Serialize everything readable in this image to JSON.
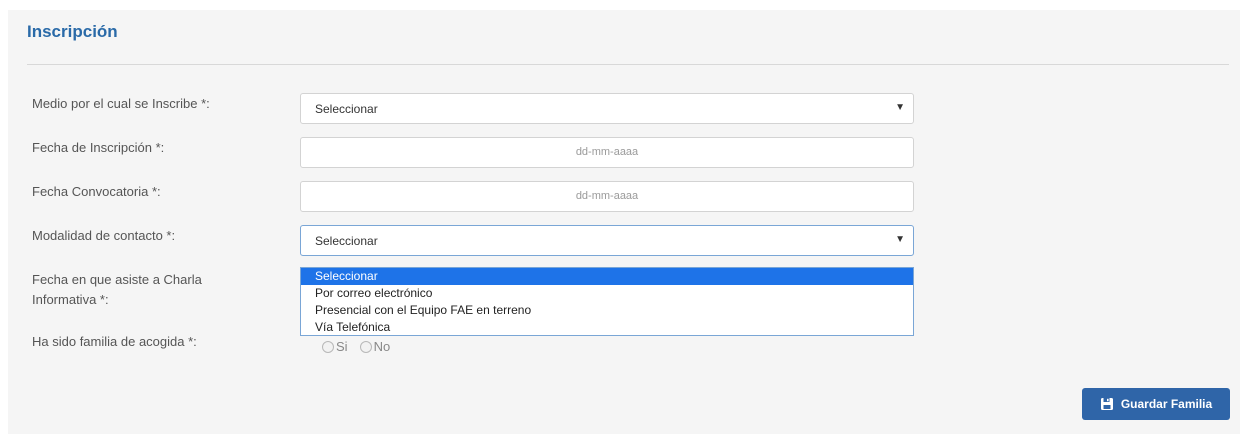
{
  "section": {
    "title": "Inscripción"
  },
  "fields": {
    "medio": {
      "label": "Medio por el cual se Inscribe *:",
      "value": "Seleccionar"
    },
    "fecha_inscripcion": {
      "label": "Fecha de Inscripción *:",
      "placeholder": "dd-mm-aaaa"
    },
    "fecha_convocatoria": {
      "label": "Fecha Convocatoria *:",
      "placeholder": "dd-mm-aaaa"
    },
    "modalidad": {
      "label": "Modalidad de contacto *:",
      "value": "Seleccionar",
      "options": [
        "Seleccionar",
        "Por correo electrónico",
        "Presencial con el Equipo FAE en terreno",
        "Vía Telefónica"
      ],
      "highlighted_option": "Seleccionar"
    },
    "charla": {
      "label_line1": "Fecha en que asiste a Charla",
      "label_line2": "Informativa *:"
    },
    "acogida": {
      "label": "Ha sido familia de acogida *:",
      "option_yes": "Si",
      "option_no": "No"
    }
  },
  "actions": {
    "save_label": "Guardar Familia"
  },
  "colors": {
    "accent": "#2f65a8",
    "title": "#2a6aa8",
    "highlight": "#1e73e8"
  },
  "icons": {
    "save": "save-icon",
    "caret": "chevron-down-icon"
  }
}
